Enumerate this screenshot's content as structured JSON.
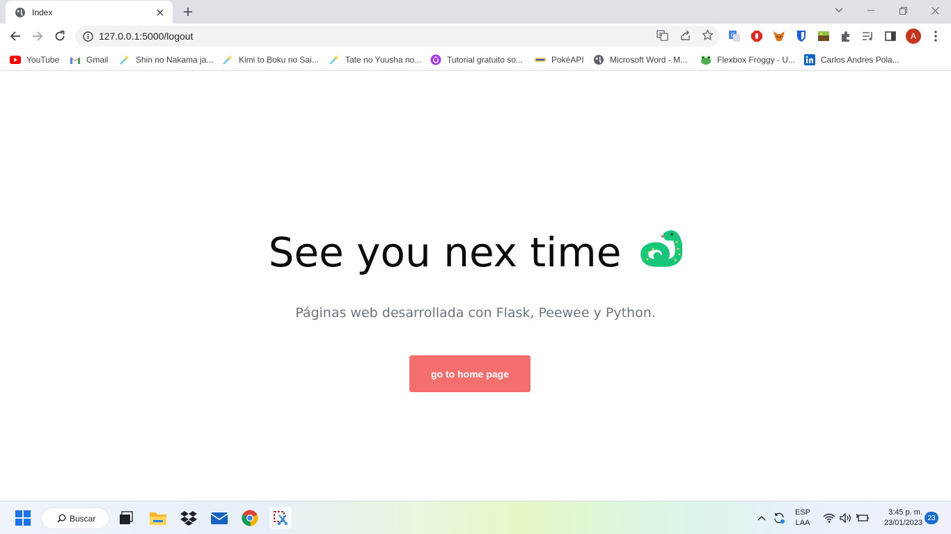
{
  "browser": {
    "tab": {
      "title": "Index"
    },
    "address_bar": {
      "url": "127.0.0.1:5000/logout"
    },
    "profile_initial": "A"
  },
  "bookmarks": [
    {
      "label": "YouTube",
      "icon": "youtube-icon"
    },
    {
      "label": "Gmail",
      "icon": "gmail-icon"
    },
    {
      "label": "Shin no Nakama ja...",
      "icon": "star-sparkle-icon"
    },
    {
      "label": "Kimi to Boku no Sai...",
      "icon": "star-sparkle-icon"
    },
    {
      "label": "Tate no Yuusha no...",
      "icon": "star-sparkle-icon"
    },
    {
      "label": "Tutorial gratuito so...",
      "icon": "udemy-icon"
    },
    {
      "label": "PokéAPI",
      "icon": "pokeapi-icon"
    },
    {
      "label": "Microsoft Word - M...",
      "icon": "globe-icon"
    },
    {
      "label": "Flexbox Froggy - U...",
      "icon": "frog-icon"
    },
    {
      "label": "Carlos Andres Pola...",
      "icon": "linkedin-icon"
    }
  ],
  "page": {
    "headline": "See you nex time",
    "subtitle": "Páginas web desarrollada con Flask, Peewee y Python.",
    "button_label": "go to home page",
    "button_color": "#f46e6e"
  },
  "taskbar": {
    "search_label": "Buscar",
    "language": "ESP",
    "layout": "LAA",
    "time": "3:45 p. m.",
    "date": "23/01/2023",
    "notification_count": "23"
  }
}
